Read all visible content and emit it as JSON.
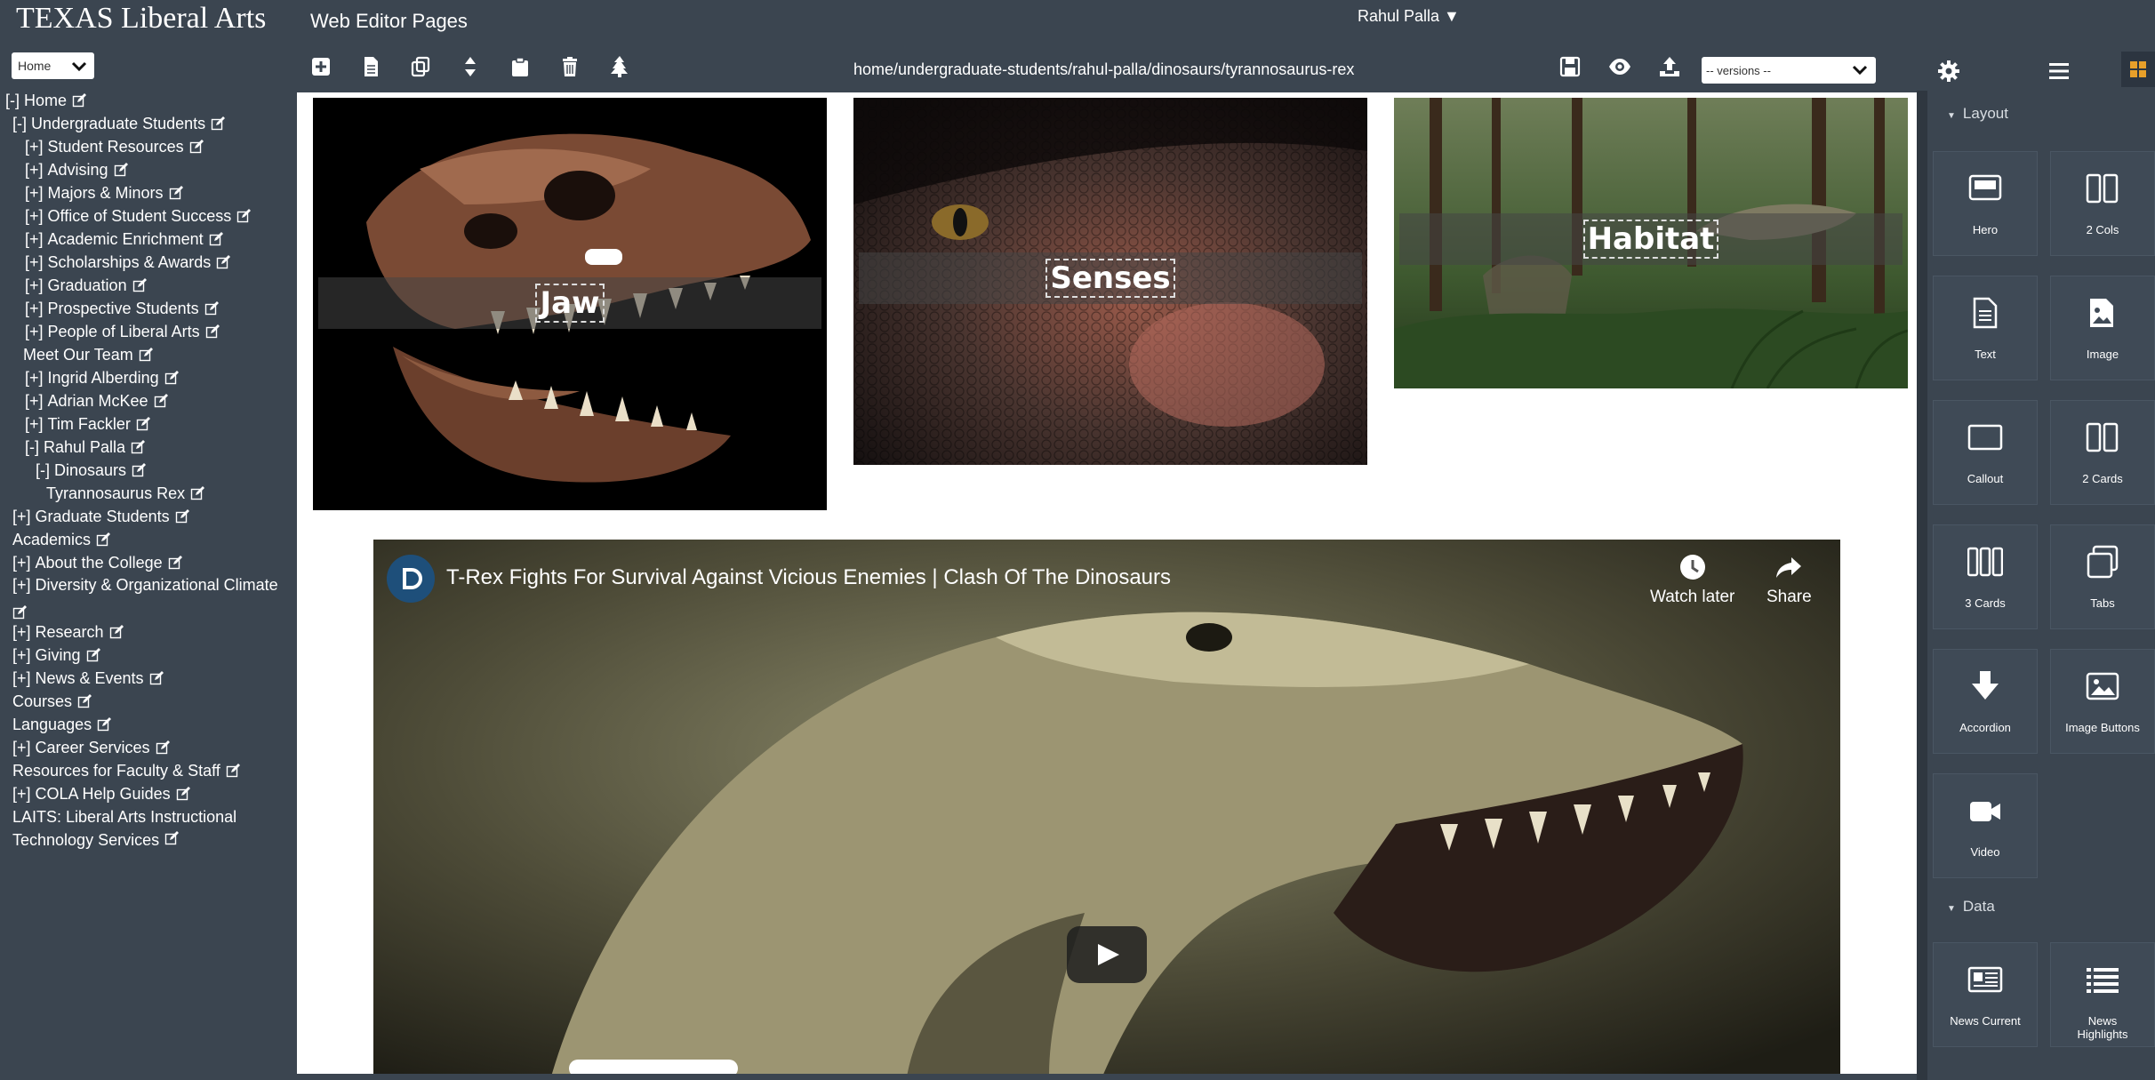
{
  "header": {
    "brand": "TEXAS Liberal Arts",
    "app_title": "Web Editor Pages",
    "user_menu": "Rahul Palla ▼"
  },
  "sidebar": {
    "site_select": "Home",
    "tree": [
      {
        "prefix": "[-] ",
        "label": "Home"
      },
      {
        "prefix": "[-] ",
        "label": "Undergraduate Students"
      },
      {
        "prefix": "[+] ",
        "label": "Student Resources"
      },
      {
        "prefix": "[+] ",
        "label": "Advising"
      },
      {
        "prefix": "[+] ",
        "label": "Majors & Minors"
      },
      {
        "prefix": "[+] ",
        "label": "Office of Student Success"
      },
      {
        "prefix": "[+] ",
        "label": "Academic Enrichment"
      },
      {
        "prefix": "[+] ",
        "label": "Scholarships & Awards"
      },
      {
        "prefix": "[+] ",
        "label": "Graduation"
      },
      {
        "prefix": "[+] ",
        "label": "Prospective Students"
      },
      {
        "prefix": "[+] ",
        "label": "People of Liberal Arts"
      },
      {
        "prefix": "",
        "label": "Meet Our Team"
      },
      {
        "prefix": "[+] ",
        "label": "Ingrid Alberding"
      },
      {
        "prefix": "[+] ",
        "label": "Adrian McKee"
      },
      {
        "prefix": "[+] ",
        "label": "Tim Fackler"
      },
      {
        "prefix": "[-] ",
        "label": "Rahul Palla"
      },
      {
        "prefix": "[-] ",
        "label": "Dinosaurs"
      },
      {
        "prefix": "",
        "label": "Tyrannosaurus Rex"
      },
      {
        "prefix": "[+] ",
        "label": "Graduate Students"
      },
      {
        "prefix": "",
        "label": "Academics"
      },
      {
        "prefix": "[+] ",
        "label": "About the College"
      },
      {
        "prefix": "[+] ",
        "label": "Diversity & Organizational Climate"
      },
      {
        "prefix": "[+] ",
        "label": "Research"
      },
      {
        "prefix": "[+] ",
        "label": "Giving"
      },
      {
        "prefix": "[+] ",
        "label": "News & Events"
      },
      {
        "prefix": "",
        "label": "Courses"
      },
      {
        "prefix": "",
        "label": "Languages"
      },
      {
        "prefix": "[+] ",
        "label": "Career Services"
      },
      {
        "prefix": "",
        "label": "Resources for Faculty & Staff"
      },
      {
        "prefix": "[+] ",
        "label": "COLA Help Guides"
      },
      {
        "prefix": "",
        "label": "LAITS: Liberal Arts Instructional Technology Services"
      }
    ]
  },
  "toolbar": {
    "icons": [
      "add-icon",
      "page-icon",
      "copy-icon",
      "reorder-icon",
      "paste-icon",
      "trash-icon",
      "tree-icon"
    ],
    "path": "home/undergraduate-students/rahul-palla/dinosaurs/tyrannosaurus-rex",
    "right_icons": [
      "save-icon",
      "preview-icon",
      "publish-icon"
    ],
    "versions_select": "-- versions --"
  },
  "content": {
    "cards": [
      {
        "label": "Jaw"
      },
      {
        "label": "Senses"
      },
      {
        "label": "Habitat"
      }
    ],
    "video": {
      "title": "T-Rex Fights For Survival Against Vicious Enemies | Clash Of The Dinosaurs",
      "watch_later": "Watch later",
      "share": "Share"
    }
  },
  "palette": {
    "top_icons": [
      "gear-icon",
      "list-icon",
      "blocks-icon"
    ],
    "layout_heading": "Layout",
    "layout_blocks": [
      {
        "label": "Hero",
        "icon": "hero-icon"
      },
      {
        "label": "2 Cols",
        "icon": "two-cols-icon"
      },
      {
        "label": "Text",
        "icon": "text-icon"
      },
      {
        "label": "Image",
        "icon": "image-icon"
      },
      {
        "label": "Callout",
        "icon": "callout-icon"
      },
      {
        "label": "2 Cards",
        "icon": "two-cards-icon"
      },
      {
        "label": "3 Cards",
        "icon": "three-cards-icon"
      },
      {
        "label": "Tabs",
        "icon": "tabs-icon"
      },
      {
        "label": "Accordion",
        "icon": "accordion-icon"
      },
      {
        "label": "Image Buttons",
        "icon": "image-buttons-icon"
      },
      {
        "label": "Video",
        "icon": "video-icon"
      }
    ],
    "data_heading": "Data",
    "data_blocks": [
      {
        "label": "News Current",
        "icon": "news-current-icon"
      },
      {
        "label": "News Highlights",
        "icon": "news-highlights-icon"
      }
    ]
  },
  "colors": {
    "chrome": "#3b4550",
    "canvas": "#ffffff",
    "block_bg": "#3f4a56",
    "accent_active": "#e8a02a"
  }
}
